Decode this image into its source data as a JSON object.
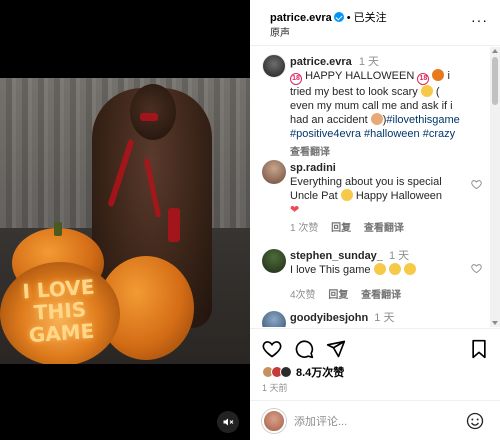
{
  "post": {
    "author": "patrice.evra",
    "follow_status": "• 已关注",
    "audio": "原声"
  },
  "caption": {
    "username": "patrice.evra",
    "time": "1 天",
    "badge_18": "18",
    "text_1": "HAPPY HALLOWEEN",
    "text_2": "i tried my best to look scary",
    "text_3": "( even my mum call me and ask if i had an accident",
    "text_4": ")",
    "hashtags": [
      "#ilovethisgame",
      "#positive4evra",
      "#halloween",
      "#crazy"
    ],
    "translate": "查看翻译"
  },
  "comments": [
    {
      "username": "sp.radini",
      "text_before": "Everything about you is special Uncle Pat",
      "text_after": "Happy Halloween",
      "likes": "1 次赞",
      "reply": "回复",
      "translate": "查看翻译"
    },
    {
      "username": "stephen_sunday_",
      "time": "1 天",
      "text": "I love This game",
      "likes": "4次赞",
      "reply": "回复",
      "translate": "查看翻译"
    },
    {
      "username": "goodyibesjohn",
      "time": "1 天"
    }
  ],
  "media": {
    "pumpkin_text": "I LOVE THIS GAME"
  },
  "actions": {
    "likes_text": "8.4万次赞",
    "time_ago": "1 天前"
  },
  "composer": {
    "placeholder": "添加评论..."
  },
  "colors": {
    "verified_blue": "#0095f6",
    "link_blue": "#00376b",
    "heart_red": "#ed4956",
    "muted_text": "#8e8e8e"
  },
  "icons": [
    "verified-icon",
    "more-icon",
    "heart-icon",
    "comment-icon",
    "share-icon",
    "bookmark-icon",
    "emoji-icon",
    "mute-icon"
  ]
}
